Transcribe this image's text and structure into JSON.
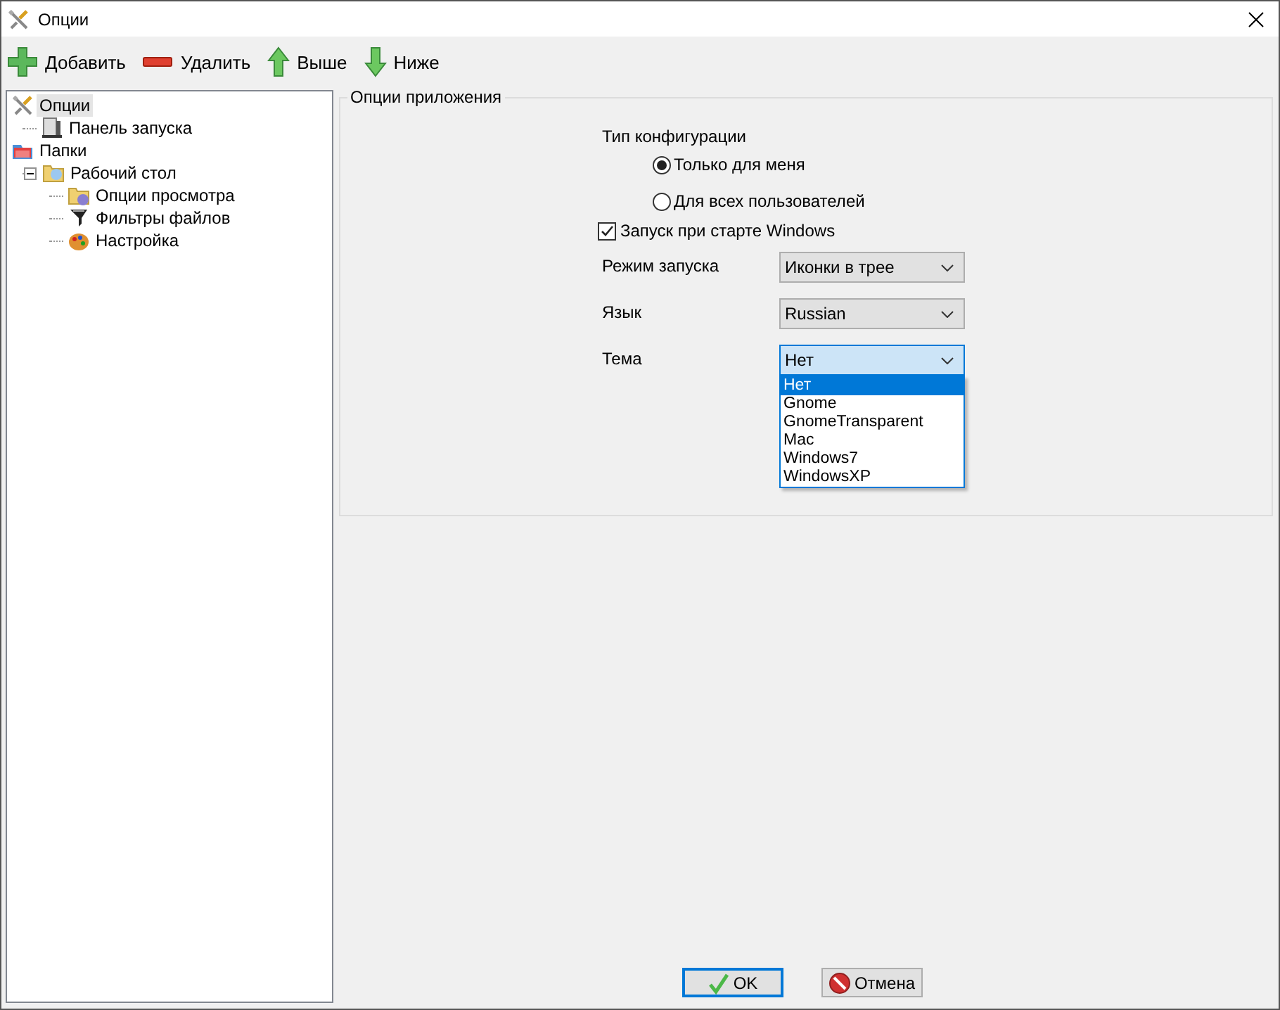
{
  "window": {
    "title": "Опции"
  },
  "toolbar": [
    {
      "kind": "add",
      "label": "Добавить"
    },
    {
      "kind": "remove",
      "label": "Удалить"
    },
    {
      "kind": "up",
      "label": "Выше"
    },
    {
      "kind": "down",
      "label": "Ниже"
    }
  ],
  "tree": [
    {
      "kind": "tools",
      "label": "Опции",
      "selected": true,
      "children": [
        {
          "kind": "panel",
          "label": "Панель запуска",
          "selected": false
        }
      ]
    },
    {
      "kind": "folders",
      "label": "Папки",
      "selected": false,
      "children": [
        {
          "kind": "desktop",
          "label": "Рабочий стол",
          "selected": false,
          "expanded": true,
          "children": [
            {
              "kind": "viewfolder",
              "label": "Опции просмотра",
              "selected": false
            },
            {
              "kind": "filter",
              "label": "Фильтры файлов",
              "selected": false
            },
            {
              "kind": "palette",
              "label": "Настройка",
              "selected": false
            }
          ]
        }
      ]
    }
  ],
  "group": {
    "title": "Опции приложения",
    "config": {
      "label": "Тип конфигурации",
      "options": [
        {
          "label": "Только для меня",
          "selected": true
        },
        {
          "label": "Для всех пользователей",
          "selected": false
        }
      ]
    },
    "autostart": {
      "label": "Запуск при старте Windows",
      "checked": true
    },
    "fields": [
      {
        "label": "Режим запуска",
        "value": "Иконки в трее",
        "open": false
      },
      {
        "label": "Язык",
        "value": "Russian",
        "open": false
      },
      {
        "label": "Тема",
        "value": "Нет",
        "open": true,
        "options": [
          {
            "label": "Нет",
            "selected": true
          },
          {
            "label": "Gnome",
            "selected": false
          },
          {
            "label": "GnomeTransparent",
            "selected": false
          },
          {
            "label": "Mac",
            "selected": false
          },
          {
            "label": "Windows7",
            "selected": false
          },
          {
            "label": "WindowsXP",
            "selected": false
          }
        ]
      }
    ]
  },
  "buttons": [
    {
      "kind": "ok",
      "label": "OK",
      "default": true
    },
    {
      "kind": "cancel",
      "label": "Отмена",
      "default": false
    }
  ]
}
